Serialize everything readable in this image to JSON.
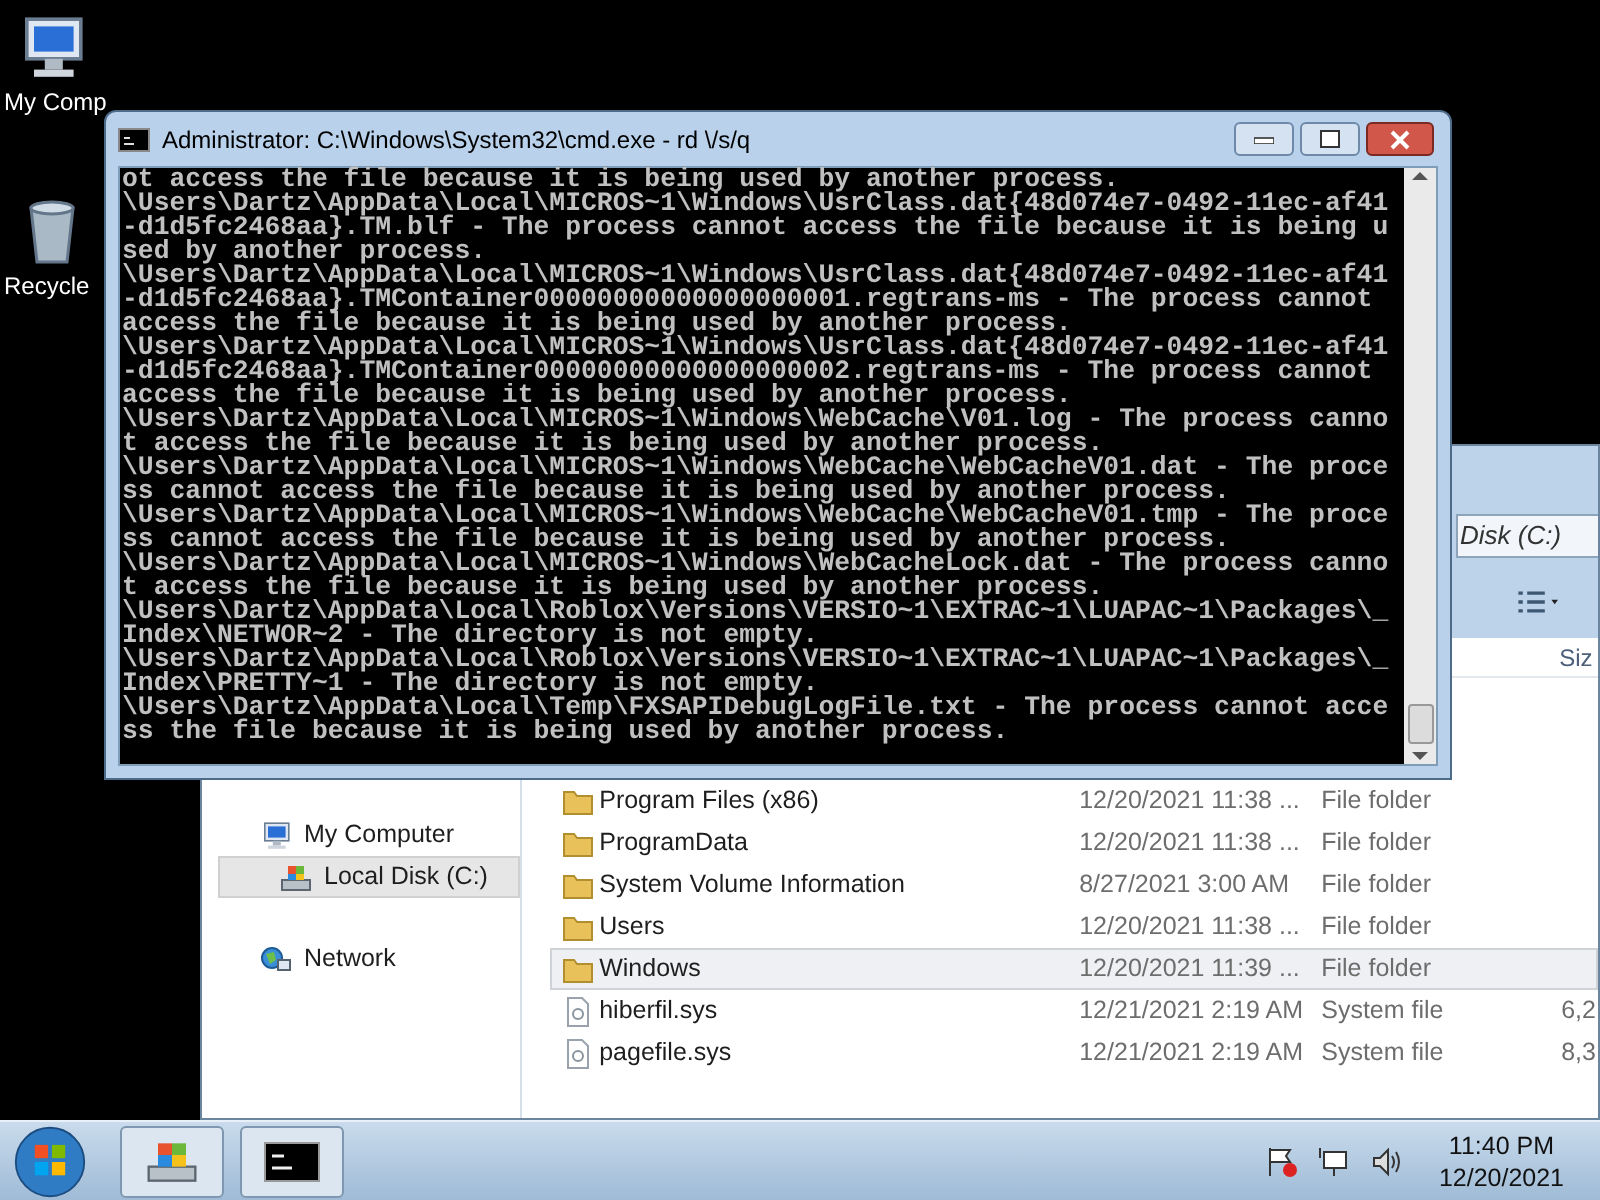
{
  "desktop_icons": [
    {
      "label": "My Comp",
      "kind": "computer"
    },
    {
      "label": "Recycle",
      "kind": "recycle"
    }
  ],
  "explorer": {
    "address": "Disk (C:)",
    "column_header": "Siz",
    "nav": [
      {
        "label": "My Computer",
        "kind": "computer",
        "selected": false
      },
      {
        "label": "Local Disk (C:)",
        "kind": "disk",
        "selected": true
      },
      {
        "label": "Network",
        "kind": "network",
        "selected": false
      }
    ],
    "rows": [
      {
        "name": "Program Files (x86)",
        "date": "12/20/2021 11:38 ...",
        "type": "File folder",
        "kind": "folder",
        "selected": false
      },
      {
        "name": "ProgramData",
        "date": "12/20/2021 11:38 ...",
        "type": "File folder",
        "kind": "folder",
        "selected": false
      },
      {
        "name": "System Volume Information",
        "date": "8/27/2021 3:00 AM",
        "type": "File folder",
        "kind": "folder",
        "selected": false
      },
      {
        "name": "Users",
        "date": "12/20/2021 11:38 ...",
        "type": "File folder",
        "kind": "folder",
        "selected": false
      },
      {
        "name": "Windows",
        "date": "12/20/2021 11:39 ...",
        "type": "File folder",
        "kind": "folder",
        "selected": true
      },
      {
        "name": "hiberfil.sys",
        "date": "12/21/2021 2:19 AM",
        "type": "System file",
        "size": "6,2",
        "kind": "file",
        "selected": false
      },
      {
        "name": "pagefile.sys",
        "date": "12/21/2021 2:19 AM",
        "type": "System file",
        "size": "8,3",
        "kind": "file",
        "selected": false
      }
    ]
  },
  "console": {
    "title": "Administrator: C:\\Windows\\System32\\cmd.exe - rd \\/s/q",
    "lines": [
      "ot access the file because it is being used by another process.",
      "\\Users\\Dartz\\AppData\\Local\\MICROS~1\\Windows\\UsrClass.dat{48d074e7-0492-11ec-af41",
      "-d1d5fc2468aa}.TM.blf - The process cannot access the file because it is being u",
      "sed by another process.",
      "\\Users\\Dartz\\AppData\\Local\\MICROS~1\\Windows\\UsrClass.dat{48d074e7-0492-11ec-af41",
      "-d1d5fc2468aa}.TMContainer00000000000000000001.regtrans-ms - The process cannot",
      "access the file because it is being used by another process.",
      "\\Users\\Dartz\\AppData\\Local\\MICROS~1\\Windows\\UsrClass.dat{48d074e7-0492-11ec-af41",
      "-d1d5fc2468aa}.TMContainer00000000000000000002.regtrans-ms - The process cannot",
      "access the file because it is being used by another process.",
      "\\Users\\Dartz\\AppData\\Local\\MICROS~1\\Windows\\WebCache\\V01.log - The process canno",
      "t access the file because it is being used by another process.",
      "\\Users\\Dartz\\AppData\\Local\\MICROS~1\\Windows\\WebCache\\WebCacheV01.dat - The proce",
      "ss cannot access the file because it is being used by another process.",
      "\\Users\\Dartz\\AppData\\Local\\MICROS~1\\Windows\\WebCache\\WebCacheV01.tmp - The proce",
      "ss cannot access the file because it is being used by another process.",
      "\\Users\\Dartz\\AppData\\Local\\MICROS~1\\Windows\\WebCacheLock.dat - The process canno",
      "t access the file because it is being used by another process.",
      "\\Users\\Dartz\\AppData\\Local\\Roblox\\Versions\\VERSIO~1\\EXTRAC~1\\LUAPAC~1\\Packages\\_",
      "Index\\NETWOR~2 - The directory is not empty.",
      "\\Users\\Dartz\\AppData\\Local\\Roblox\\Versions\\VERSIO~1\\EXTRAC~1\\LUAPAC~1\\Packages\\_",
      "Index\\PRETTY~1 - The directory is not empty.",
      "\\Users\\Dartz\\AppData\\Local\\Temp\\FXSAPIDebugLogFile.txt - The process cannot acce",
      "ss the file because it is being used by another process."
    ]
  },
  "taskbar": {
    "buttons": [
      {
        "kind": "explorer"
      },
      {
        "kind": "console"
      }
    ],
    "time": "11:40 PM",
    "date": "12/20/2021"
  }
}
